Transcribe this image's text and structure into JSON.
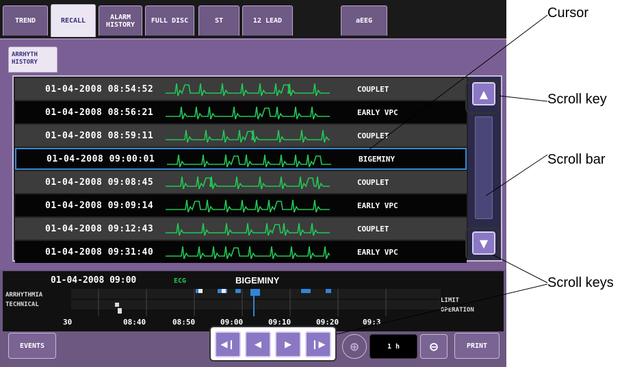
{
  "tabs": [
    "TREND",
    "RECALL",
    "ALARM HISTORY",
    "FULL DISC",
    "ST",
    "12 LEAD",
    "aEEG"
  ],
  "subtab": "ARRHYTH HISTORY",
  "rows": [
    {
      "datetime": "01-04-2008  08:54:52",
      "event": "COUPLET"
    },
    {
      "datetime": "01-04-2008  08:56:21",
      "event": "EARLY VPC"
    },
    {
      "datetime": "01-04-2008  08:59:11",
      "event": "COUPLET"
    },
    {
      "datetime": "01-04-2008  09:00:01",
      "event": "BIGEMINY"
    },
    {
      "datetime": "01-04-2008  09:08:45",
      "event": "COUPLET"
    },
    {
      "datetime": "01-04-2008  09:09:14",
      "event": "EARLY VPC"
    },
    {
      "datetime": "01-04-2008  09:12:43",
      "event": "COUPLET"
    },
    {
      "datetime": "01-04-2008  09:31:40",
      "event": "EARLY VPC"
    }
  ],
  "selected_row": 3,
  "trend": {
    "datetime": "01-04-2008  09:00",
    "source": "ECG",
    "event": "BIGEMINY",
    "row_labels": [
      "ARRHYTHMIA",
      "TECHNICAL"
    ],
    "limit_label": "LIMIT",
    "operation_label": "OPERATION",
    "time_ticks": [
      "30",
      "08:40",
      "08:50",
      "09:00",
      "09:10",
      "09:20",
      "09:3"
    ]
  },
  "controls": {
    "events": "EVENTS",
    "zoom_value": "1 h",
    "print": "PRINT"
  },
  "callouts": {
    "cursor": "Cursor",
    "scroll_key": "Scroll key",
    "scroll_bar": "Scroll bar",
    "scroll_keys": "Scroll keys"
  },
  "colors": {
    "ecg_wave": "#22c755",
    "cursor_border": "#3a86d8",
    "panel": "#7a5f94",
    "accent_blue": "#2f86d8"
  },
  "icons": [
    "up-arrow-icon",
    "down-arrow-icon",
    "skip-first-icon",
    "step-back-icon",
    "step-forward-icon",
    "skip-last-icon",
    "zoom-in-icon",
    "zoom-out-icon"
  ]
}
